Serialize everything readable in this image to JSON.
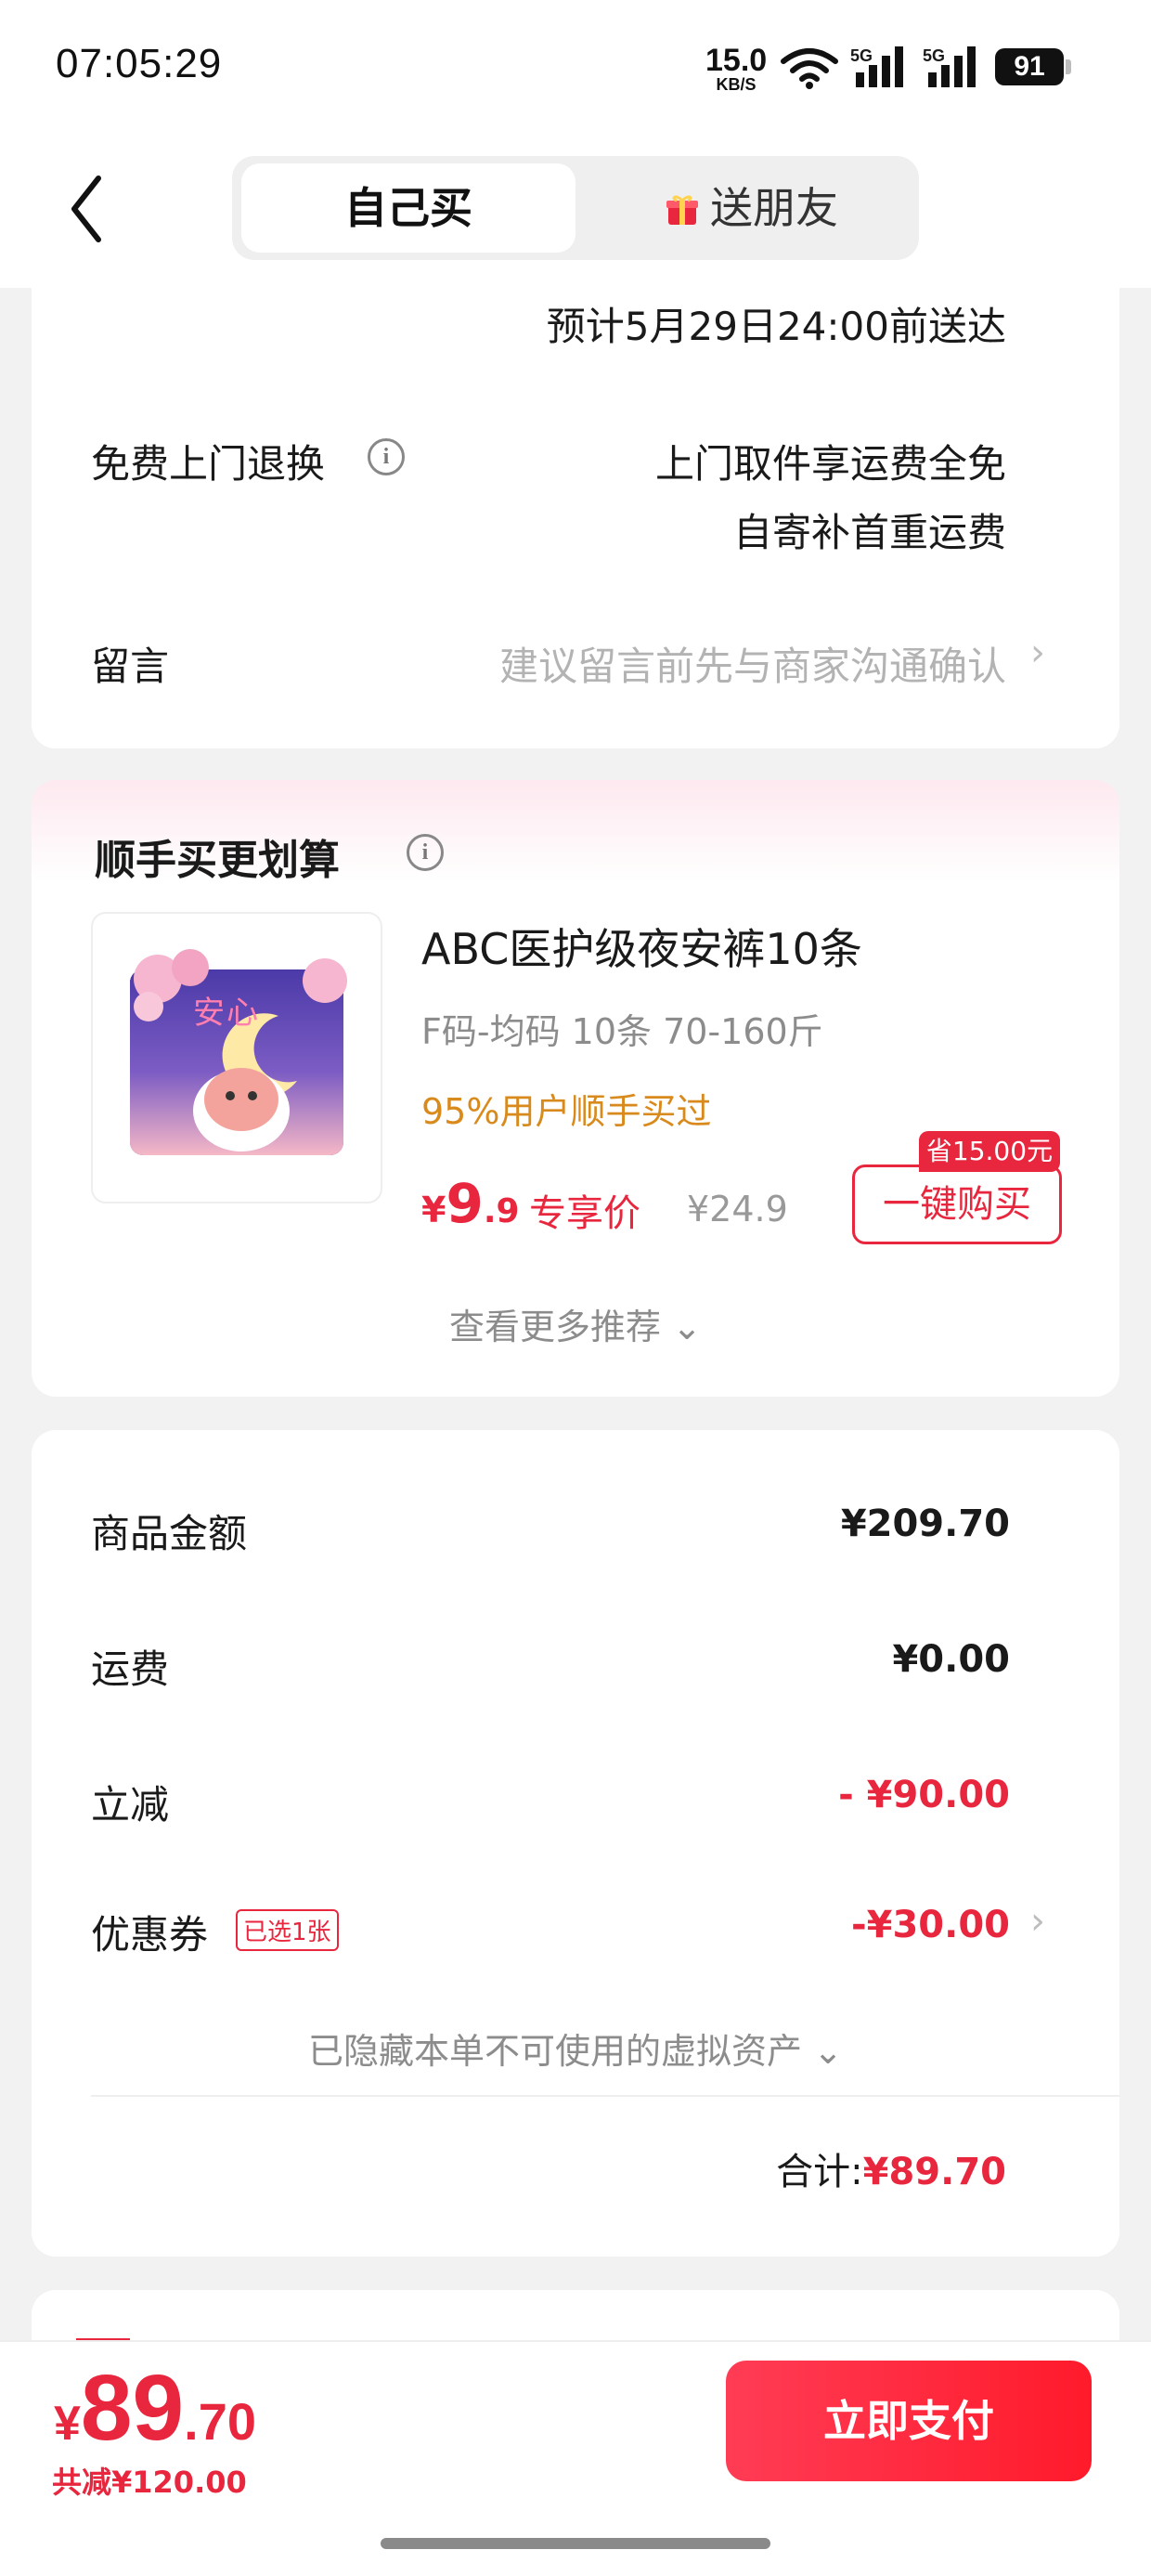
{
  "status_bar": {
    "time": "07:05:29",
    "net_speed_value": "15.0",
    "net_speed_unit": "KB/S",
    "signal1_label": "5G",
    "signal2_label": "5G",
    "battery": "91"
  },
  "header": {
    "tab_self": "自己买",
    "tab_friend": "送朋友"
  },
  "delivery": {
    "estimate": "预计5月29日24:00前送达",
    "return_label": "免费上门退换",
    "return_line1": "上门取件享运费全免",
    "return_line2": "自寄补首重运费",
    "message_label": "留言",
    "message_placeholder": "建议留言前先与商家沟通确认"
  },
  "addon": {
    "title": "顺手买更划算",
    "product_name": "ABC医护级夜安裤10条",
    "product_spec": "F码-均码 10条 70-160斤",
    "social_proof": "95%用户顺手买过",
    "price_symbol": "¥",
    "price_int": "9",
    "price_dec": ".9",
    "price_label": "专享价",
    "original_price": "¥24.9",
    "save_tag": "省15.00元",
    "buy_button": "一键购买",
    "more": "查看更多推荐"
  },
  "summary": {
    "goods_label": "商品金额",
    "goods_value": "¥209.70",
    "shipping_label": "运费",
    "shipping_value": "¥0.00",
    "discount_label": "立减",
    "discount_value": "- ¥90.00",
    "coupon_label": "优惠券",
    "coupon_badge": "已选1张",
    "coupon_value": "-¥30.00",
    "hidden_assets": "已隐藏本单不可使用的虚拟资产",
    "total_label": "合计:",
    "total_value": "¥89.70"
  },
  "bottom": {
    "currency": "¥",
    "price_int": "89",
    "price_dec": ".70",
    "saved": "共减¥120.00",
    "pay_button": "立即支付"
  },
  "colors": {
    "accent_red": "#e8273f",
    "orange": "#d98a1c"
  }
}
